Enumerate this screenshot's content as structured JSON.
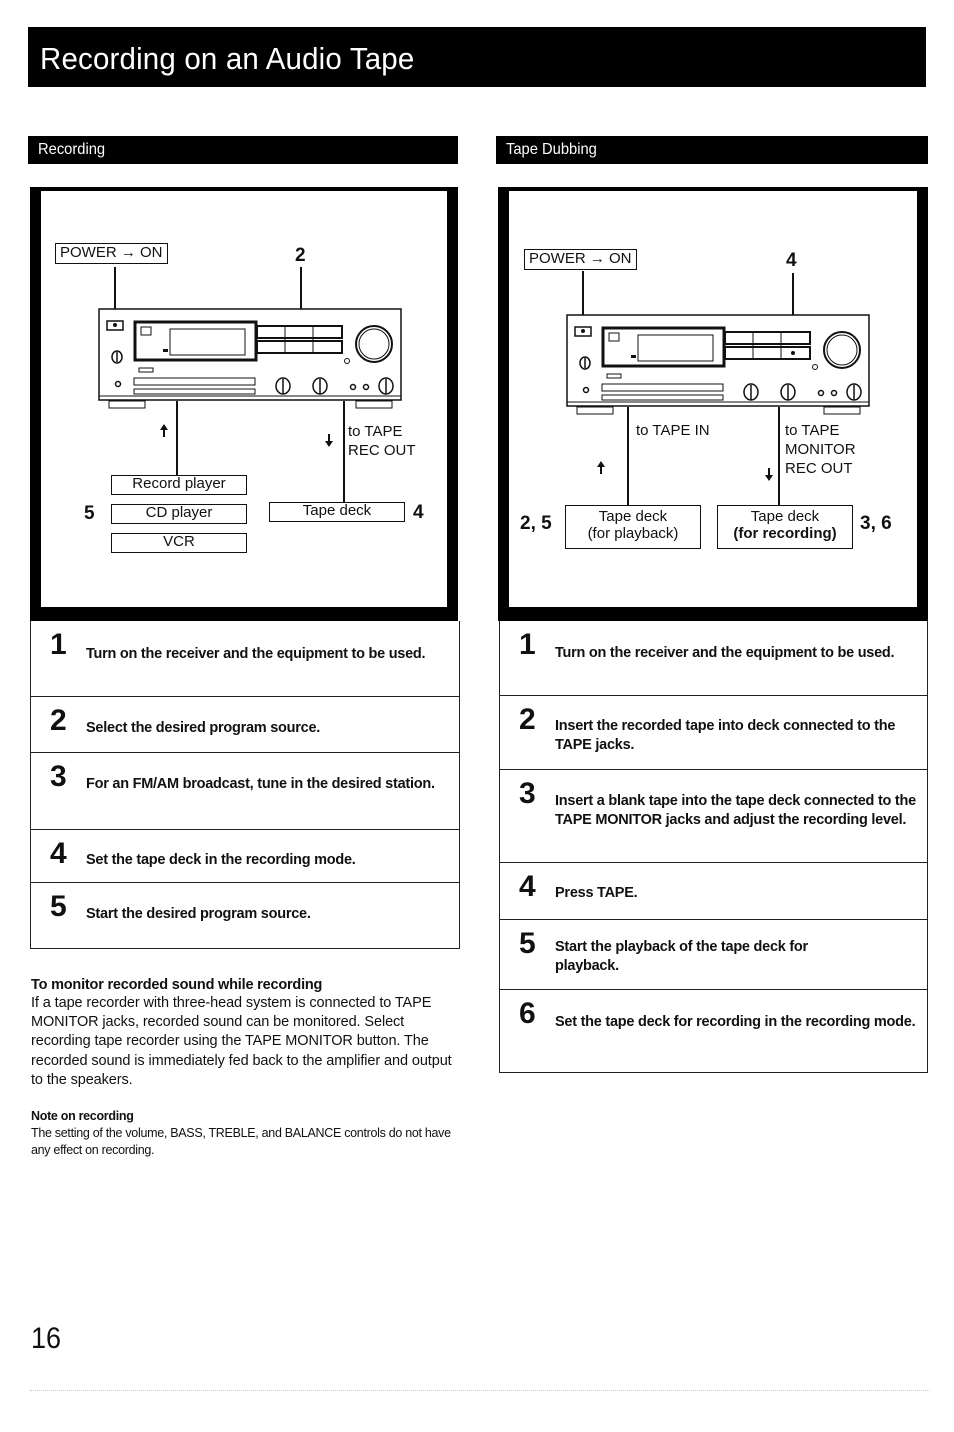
{
  "page": {
    "title": "Recording on an Audio Tape",
    "page_number": "16"
  },
  "recording": {
    "header": "Recording",
    "figure": {
      "power_label": "POWER → ON",
      "step_marker_top": "2",
      "signal_label_line1": "to TAPE",
      "signal_label_line2": "REC OUT",
      "sources": [
        "Record player",
        "CD player",
        "VCR"
      ],
      "sources_step": "5",
      "tape_deck": "Tape deck",
      "tape_deck_step": "4",
      "arrow_up": "up-arrow",
      "arrow_down": "down-arrow"
    },
    "steps": [
      {
        "num": "1",
        "text": "Turn on the receiver and the equipment to be used."
      },
      {
        "num": "2",
        "text": "Select the desired program source."
      },
      {
        "num": "3",
        "text": "For an FM/AM broadcast, tune in the desired station."
      },
      {
        "num": "4",
        "text": "Set the tape deck in the recording mode."
      },
      {
        "num": "5",
        "text": "Start the desired program source."
      }
    ],
    "monitor_note": {
      "heading": "To monitor recorded sound while recording",
      "body": "If a tape recorder with three-head system is connected to TAPE MONITOR jacks, recorded sound can be monitored. Select recording tape recorder using the TAPE MONITOR button. The recorded sound is immediately fed back to the amplifier and output to the speakers."
    },
    "recording_note": {
      "heading": "Note on recording",
      "body": "The setting of the volume, BASS, TREBLE, and BALANCE controls do not have any effect on recording."
    }
  },
  "dubbing": {
    "header": "Tape Dubbing",
    "figure": {
      "power_label": "POWER → ON",
      "step_marker_top": "4",
      "in_label": "to TAPE IN",
      "out_label_line1": "to TAPE",
      "out_label_line2": "MONITOR",
      "out_label_line3": "REC OUT",
      "playback_deck_line1": "Tape deck",
      "playback_deck_line2": "(for playback)",
      "playback_step": "2, 5",
      "recording_deck_line1": "Tape deck",
      "recording_deck_line2": "(for recording)",
      "recording_step": "3, 6"
    },
    "steps": [
      {
        "num": "1",
        "text": "Turn on the receiver and the equipment to be used."
      },
      {
        "num": "2",
        "text": "Insert the recorded tape into deck connected to the TAPE jacks."
      },
      {
        "num": "3",
        "text": "Insert a blank tape into the tape deck connected to the TAPE MONITOR jacks and adjust the recording level."
      },
      {
        "num": "4",
        "text": "Press TAPE."
      },
      {
        "num": "5",
        "text": "Start the playback of the tape deck for playback."
      },
      {
        "num": "6",
        "text": "Set the tape deck for recording in the recording mode."
      }
    ]
  }
}
